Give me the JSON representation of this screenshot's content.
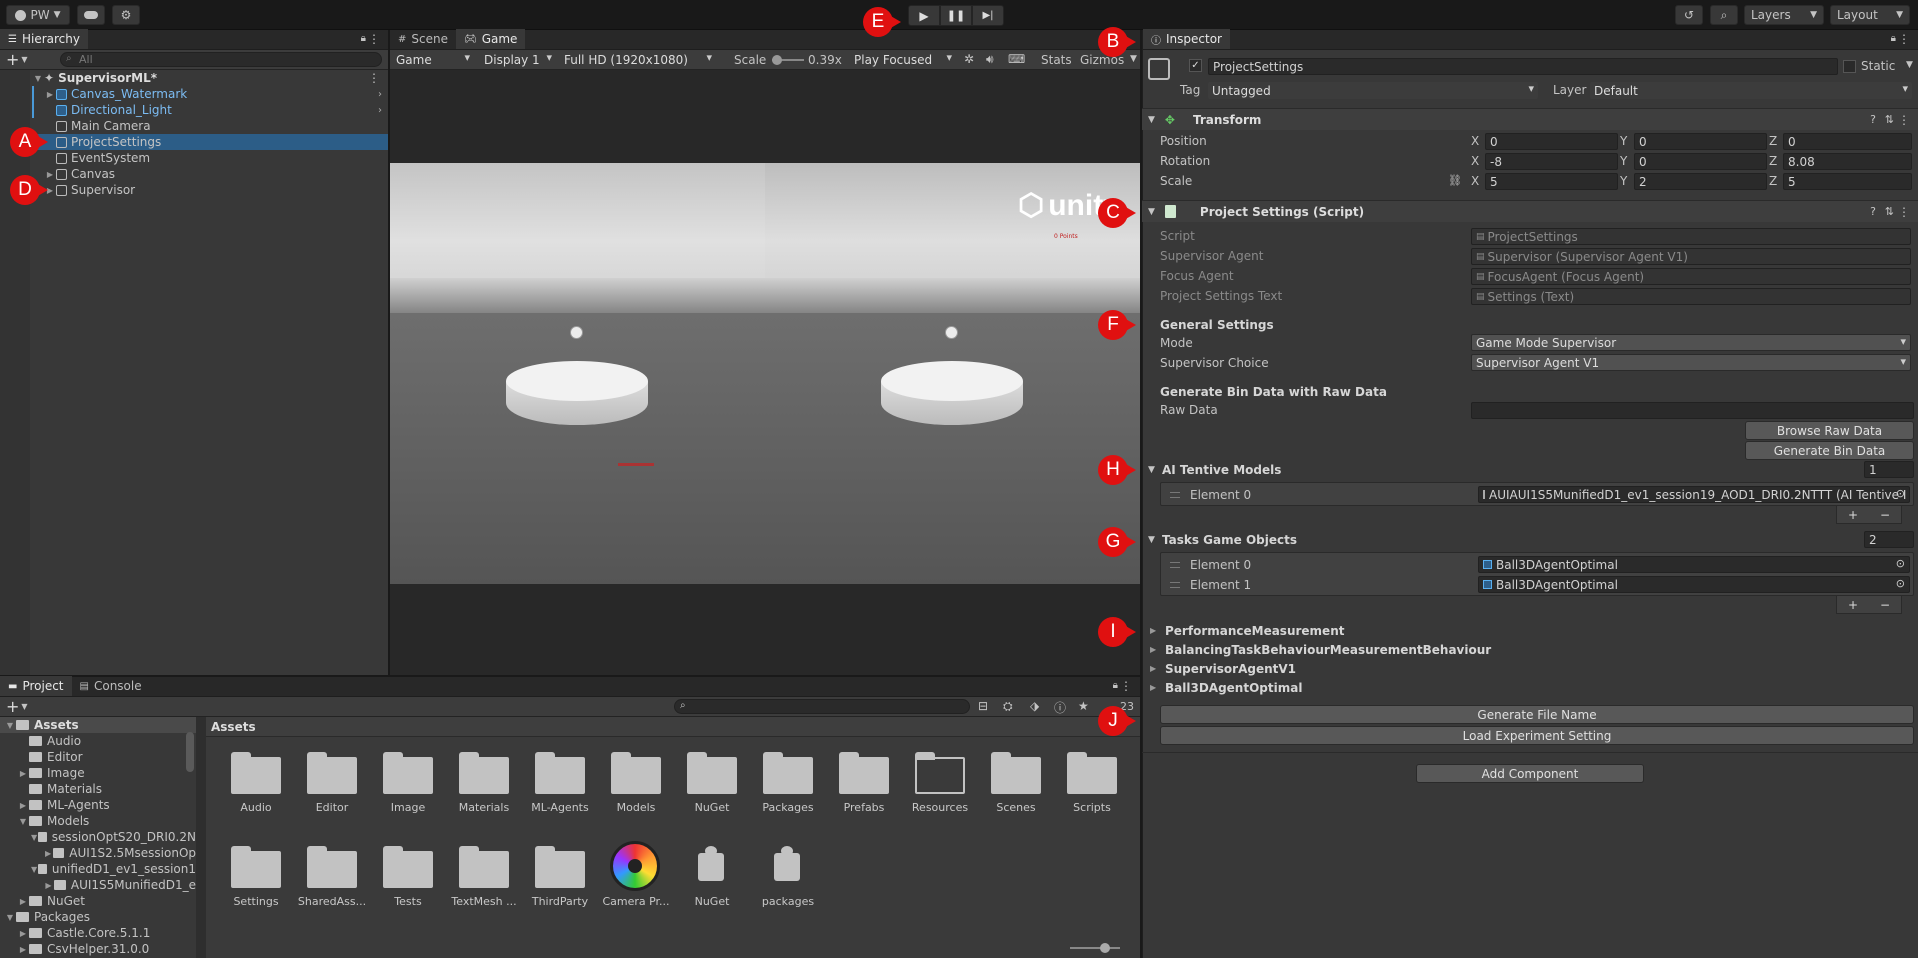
{
  "topbar": {
    "account": "PW",
    "layers": "Layers",
    "layout": "Layout"
  },
  "hierarchy": {
    "tab": "Hierarchy",
    "search_placeholder": "All",
    "scene": "SupervisorML*",
    "items": [
      {
        "label": "Canvas_Watermark",
        "prefab": true,
        "expandable": true
      },
      {
        "label": "Directional_Light",
        "prefab": true,
        "expandable": false
      },
      {
        "label": "Main Camera",
        "prefab": false,
        "expandable": false
      },
      {
        "label": "ProjectSettings",
        "prefab": false,
        "expandable": false,
        "selected": true
      },
      {
        "label": "EventSystem",
        "prefab": false,
        "expandable": false
      },
      {
        "label": "Canvas",
        "prefab": false,
        "expandable": true
      },
      {
        "label": "Supervisor",
        "prefab": false,
        "expandable": true
      }
    ]
  },
  "scene_view": {
    "tab_scene": "Scene",
    "tab_game": "Game",
    "display_mode": "Game",
    "display": "Display 1",
    "resolution": "Full HD (1920x1080)",
    "scale_label": "Scale",
    "scale_value": "0.39x",
    "play_focus": "Play Focused",
    "stats": "Stats",
    "gizmos": "Gizmos",
    "unity_text": "unity",
    "small_red_text": "0 Points"
  },
  "inspector": {
    "tab": "Inspector",
    "object_name": "ProjectSettings",
    "static_label": "Static",
    "tag_label": "Tag",
    "tag_value": "Untagged",
    "layer_label": "Layer",
    "layer_value": "Default",
    "transform": {
      "title": "Transform",
      "position_label": "Position",
      "rotation_label": "Rotation",
      "scale_label": "Scale",
      "position": [
        "0",
        "0",
        "0"
      ],
      "rotation": [
        "-8",
        "0",
        "8.08"
      ],
      "scale": [
        "5",
        "2",
        "5"
      ]
    },
    "script_component": {
      "title": "Project Settings (Script)",
      "script_label": "Script",
      "script_value": "ProjectSettings",
      "supervisor_agent_label": "Supervisor Agent",
      "supervisor_agent_value": "Supervisor (Supervisor Agent V1)",
      "focus_agent_label": "Focus Agent",
      "focus_agent_value": "FocusAgent (Focus Agent)",
      "settings_text_label": "Project Settings Text",
      "settings_text_value": "Settings (Text)",
      "general_settings": "General Settings",
      "mode_label": "Mode",
      "mode_value": "Game Mode Supervisor",
      "supervisor_choice_label": "Supervisor Choice",
      "supervisor_choice_value": "Supervisor Agent V1",
      "bin_data_header": "Generate Bin Data with Raw Data",
      "raw_data_label": "Raw Data",
      "browse_raw_data": "Browse Raw Data",
      "generate_bin_data": "Generate Bin Data",
      "ai_models_label": "AI Tentive Models",
      "ai_models_count": "1",
      "ai_models": [
        {
          "label": "Element 0",
          "value": "AUIAUI1S5MunifiedD1_ev1_session19_AOD1_DRI0.2NTTT (AI Tentive I"
        }
      ],
      "tasks_label": "Tasks Game Objects",
      "tasks_count": "2",
      "tasks": [
        {
          "label": "Element 0",
          "value": "Ball3DAgentOptimal"
        },
        {
          "label": "Element 1",
          "value": "Ball3DAgentOptimal"
        }
      ],
      "plus": "+",
      "minus": "−"
    },
    "collapsed_components": [
      "PerformanceMeasurement",
      "BalancingTaskBehaviourMeasurementBehaviour",
      "SupervisorAgentV1",
      "Ball3DAgentOptimal"
    ],
    "generate_file_name": "Generate File Name",
    "load_experiment": "Load Experiment Setting",
    "add_component": "Add Component"
  },
  "project": {
    "tab_project": "Project",
    "tab_console": "Console",
    "count_badge": "23",
    "breadcrumb": "Assets",
    "tree": [
      {
        "label": "Assets",
        "indent": 0,
        "arrow": "open",
        "bold": true
      },
      {
        "label": "Audio",
        "indent": 1,
        "arrow": ""
      },
      {
        "label": "Editor",
        "indent": 1,
        "arrow": ""
      },
      {
        "label": "Image",
        "indent": 1,
        "arrow": "closed"
      },
      {
        "label": "Materials",
        "indent": 1,
        "arrow": ""
      },
      {
        "label": "ML-Agents",
        "indent": 1,
        "arrow": "closed"
      },
      {
        "label": "Models",
        "indent": 1,
        "arrow": "open"
      },
      {
        "label": "sessionOptS20_DRI0.2N",
        "indent": 2,
        "arrow": "open"
      },
      {
        "label": "AUI1S2.5MsessionOp",
        "indent": 3,
        "arrow": "closed"
      },
      {
        "label": "unifiedD1_ev1_session1",
        "indent": 2,
        "arrow": "open"
      },
      {
        "label": "AUI1S5MunifiedD1_e",
        "indent": 3,
        "arrow": "closed"
      },
      {
        "label": "NuGet",
        "indent": 1,
        "arrow": "closed"
      },
      {
        "label": "Packages",
        "indent": 0,
        "arrow": "open"
      },
      {
        "label": "Castle.Core.5.1.1",
        "indent": 1,
        "arrow": "closed"
      },
      {
        "label": "CsvHelper.31.0.0",
        "indent": 1,
        "arrow": "closed"
      }
    ],
    "assets_row1": [
      "Audio",
      "Editor",
      "Image",
      "Materials",
      "ML-Agents",
      "Models",
      "NuGet",
      "Packages",
      "Prefabs",
      "Resources",
      "Scenes",
      "Scripts"
    ],
    "assets_row2": [
      "Settings",
      "SharedAss...",
      "Tests",
      "TextMesh ...",
      "ThirdParty",
      "Camera Pr...",
      "NuGet",
      "packages"
    ]
  },
  "markers": [
    "A",
    "B",
    "C",
    "D",
    "E",
    "F",
    "G",
    "H",
    "I",
    "J"
  ]
}
